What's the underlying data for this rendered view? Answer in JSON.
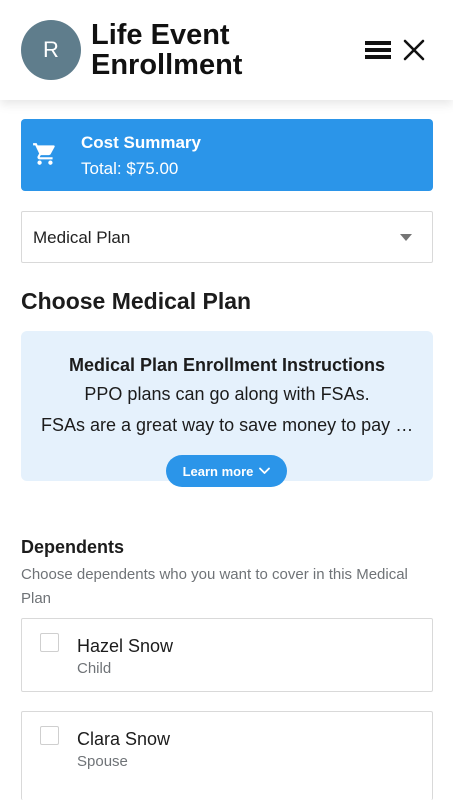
{
  "header": {
    "avatar_initial": "R",
    "title": "Life Event Enrollment",
    "menu_icon": "hamburger-menu-icon",
    "close_icon": "close-icon"
  },
  "cost_summary": {
    "icon": "shopping-cart-icon",
    "title": "Cost Summary",
    "total": "Total: $75.00",
    "color": "#2b95e9"
  },
  "plan_select": {
    "value": "Medical Plan"
  },
  "section_title": "Choose Medical Plan",
  "instructions": {
    "title": "Medical Plan Enrollment Instructions",
    "line1": "PPO plans can go along with FSAs.",
    "line2": "FSAs are a great way to save money to pay for health care expenses",
    "learn_more": "Learn more",
    "background": "#e5f1fc"
  },
  "dependents": {
    "title": "Dependents",
    "description": "Choose dependents who you want to cover in this Medical Plan",
    "items": [
      {
        "name": "Hazel Snow",
        "relation": "Child",
        "checked": false
      },
      {
        "name": "Clara Snow",
        "relation": "Spouse",
        "checked": false
      }
    ]
  }
}
